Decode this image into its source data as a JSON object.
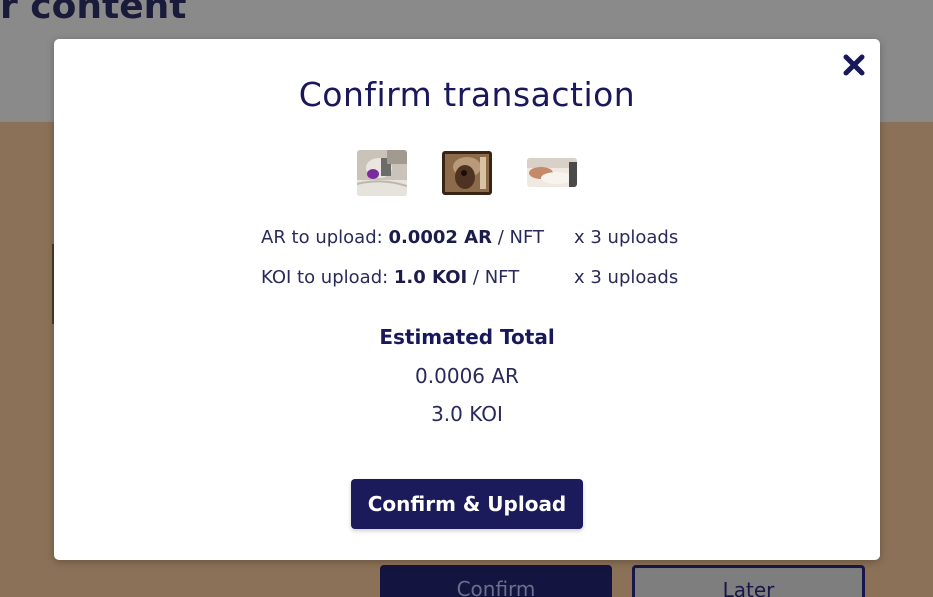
{
  "background": {
    "page_heading": "r content",
    "confirm_label": "Confirm",
    "later_label": "Later"
  },
  "modal": {
    "title": "Confirm transaction",
    "close_icon": "close-icon",
    "thumbnails": [
      "nft-thumbnail-1",
      "nft-thumbnail-2",
      "nft-thumbnail-3"
    ],
    "ar_row": {
      "prefix": "AR to upload: ",
      "amount": "0.0002 AR",
      "suffix": " / NFT",
      "multiplier": "x 3 uploads"
    },
    "koi_row": {
      "prefix": "KOI to upload: ",
      "amount": "1.0 KOI",
      "suffix": " / NFT",
      "multiplier": "x 3 uploads"
    },
    "estimated_total": {
      "title": "Estimated Total",
      "ar": "0.0006 AR",
      "koi": "3.0 KOI"
    },
    "primary_button": "Confirm & Upload"
  },
  "colors": {
    "navy": "#1b1b5c",
    "overlay_header": "#8a8a8a",
    "overlay_content": "#8b7157",
    "modal_bg": "#ffffff"
  }
}
